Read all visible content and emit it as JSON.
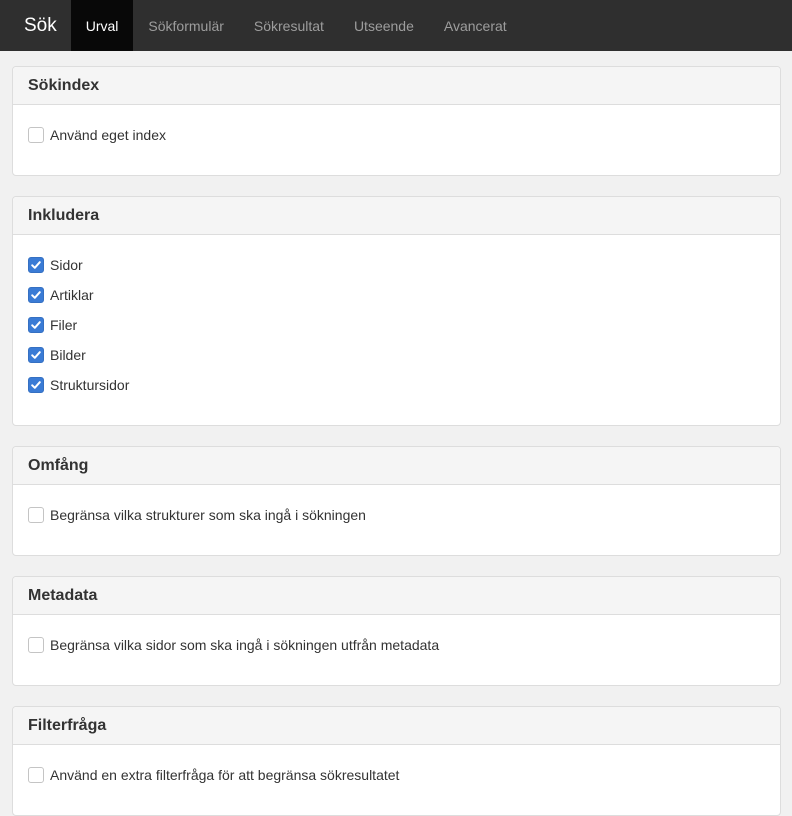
{
  "navbar": {
    "brand": "Sök",
    "tabs": [
      {
        "label": "Urval",
        "active": true
      },
      {
        "label": "Sökformulär",
        "active": false
      },
      {
        "label": "Sökresultat",
        "active": false
      },
      {
        "label": "Utseende",
        "active": false
      },
      {
        "label": "Avancerat",
        "active": false
      }
    ]
  },
  "panels": {
    "sokindex": {
      "title": "Sökindex",
      "items": [
        {
          "label": "Använd eget index",
          "checked": false
        }
      ]
    },
    "inkludera": {
      "title": "Inkludera",
      "items": [
        {
          "label": "Sidor",
          "checked": true
        },
        {
          "label": "Artiklar",
          "checked": true
        },
        {
          "label": "Filer",
          "checked": true
        },
        {
          "label": "Bilder",
          "checked": true
        },
        {
          "label": "Struktursidor",
          "checked": true
        }
      ]
    },
    "omfang": {
      "title": "Omfång",
      "items": [
        {
          "label": "Begränsa vilka strukturer som ska ingå i sökningen",
          "checked": false
        }
      ]
    },
    "metadata": {
      "title": "Metadata",
      "items": [
        {
          "label": "Begränsa vilka sidor som ska ingå i sökningen utfrån metadata",
          "checked": false
        }
      ]
    },
    "filterfraga": {
      "title": "Filterfråga",
      "items": [
        {
          "label": "Använd en extra filterfråga för att begränsa sökresultatet",
          "checked": false
        }
      ]
    }
  },
  "colors": {
    "navbar_bg": "#2f2f2f",
    "active_tab_bg": "#080808",
    "checkbox_checked": "#3a7bd5"
  },
  "icons": {
    "checkbox_checked": "check-icon"
  }
}
